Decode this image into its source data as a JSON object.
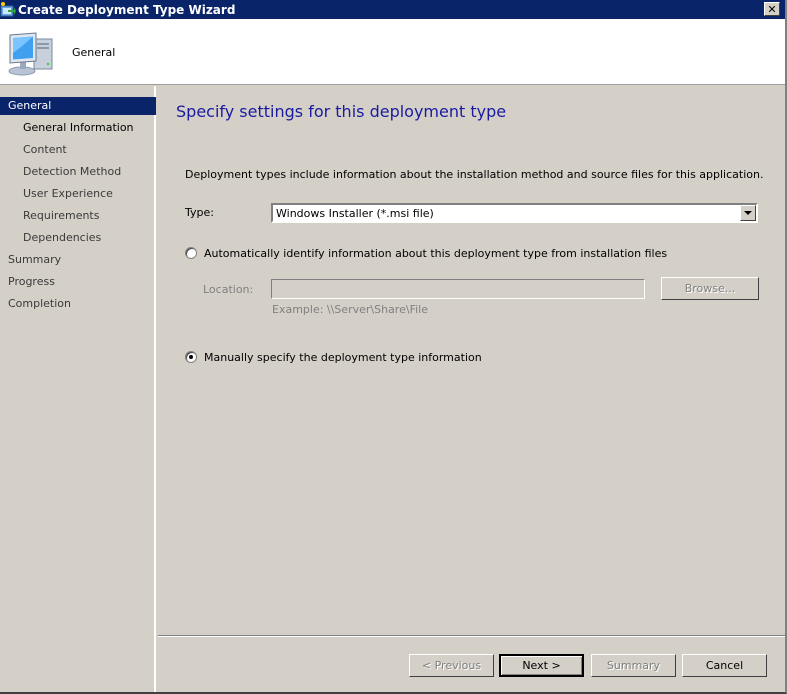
{
  "window": {
    "title": "Create Deployment Type Wizard",
    "app_icon": "wizard-app-icon",
    "close_label": "✕"
  },
  "header": {
    "icon": "computer-icon",
    "title": "General"
  },
  "sidebar": {
    "items": [
      {
        "label": "General",
        "level": 0,
        "state": "selected"
      },
      {
        "label": "General Information",
        "level": 1,
        "state": "current"
      },
      {
        "label": "Content",
        "level": 1,
        "state": "normal"
      },
      {
        "label": "Detection Method",
        "level": 1,
        "state": "normal"
      },
      {
        "label": "User Experience",
        "level": 1,
        "state": "normal"
      },
      {
        "label": "Requirements",
        "level": 1,
        "state": "normal"
      },
      {
        "label": "Dependencies",
        "level": 1,
        "state": "normal"
      },
      {
        "label": "Summary",
        "level": 0,
        "state": "normal"
      },
      {
        "label": "Progress",
        "level": 0,
        "state": "normal"
      },
      {
        "label": "Completion",
        "level": 0,
        "state": "normal"
      }
    ]
  },
  "main": {
    "page_title": "Specify settings for this deployment type",
    "description": "Deployment types include information about the installation method and source files for this application.",
    "type_label": "Type:",
    "type_value": "Windows Installer (*.msi file)",
    "auto_option": {
      "label": "Automatically identify information about this deployment type from installation files",
      "checked": false
    },
    "location_label": "Location:",
    "location_value": "",
    "browse_label": "Browse...",
    "example_text": "Example: \\\\Server\\Share\\File",
    "manual_option": {
      "label": "Manually specify the deployment type information",
      "checked": true
    }
  },
  "footer": {
    "previous_label": "< Previous",
    "next_label": "Next >",
    "summary_label": "Summary",
    "cancel_label": "Cancel"
  },
  "colors": {
    "titlebar": "#0a246a",
    "selection": "#0a246a",
    "page_title": "#1a1aa0",
    "face": "#d4d0c8"
  }
}
